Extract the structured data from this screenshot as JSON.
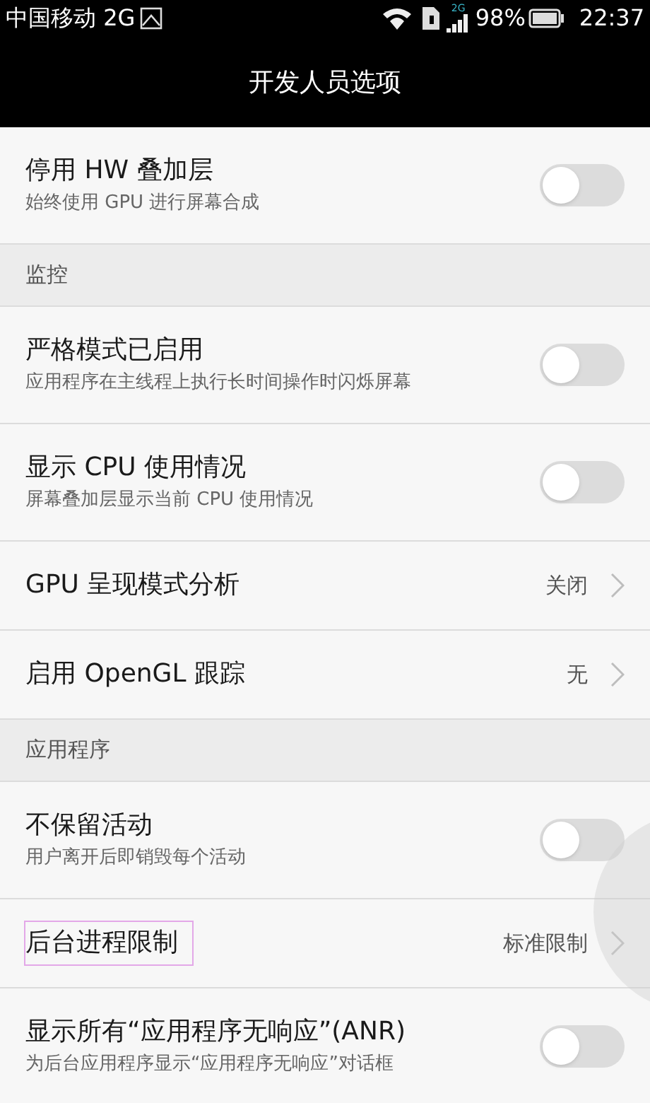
{
  "status_bar": {
    "carrier": "中国移动 2G",
    "network_badge": "2G",
    "battery": "98%",
    "time": "22:37"
  },
  "title": "开发人员选项",
  "items": [
    {
      "kind": "toggle",
      "title": "停用 HW 叠加层",
      "subtitle": "始终使用 GPU 进行屏幕合成",
      "on": false
    },
    {
      "kind": "header",
      "title": "监控"
    },
    {
      "kind": "toggle",
      "title": "严格模式已启用",
      "subtitle": "应用程序在主线程上执行长时间操作时闪烁屏幕",
      "on": false
    },
    {
      "kind": "toggle",
      "title": "显示 CPU 使用情况",
      "subtitle": "屏幕叠加层显示当前 CPU 使用情况",
      "on": false
    },
    {
      "kind": "value",
      "title": "GPU 呈现模式分析",
      "value": "关闭",
      "annotated": false
    },
    {
      "kind": "value",
      "title": "启用 OpenGL 跟踪",
      "value": "无",
      "annotated": false
    },
    {
      "kind": "header",
      "title": "应用程序"
    },
    {
      "kind": "toggle",
      "title": "不保留活动",
      "subtitle": "用户离开后即销毁每个活动",
      "on": false
    },
    {
      "kind": "value",
      "title": "后台进程限制",
      "value": "标准限制",
      "annotated": true
    },
    {
      "kind": "toggle",
      "title": "显示所有“应用程序无响应”(ANR)",
      "subtitle": "为后台应用程序显示“应用程序无响应”对话框",
      "on": false
    }
  ]
}
